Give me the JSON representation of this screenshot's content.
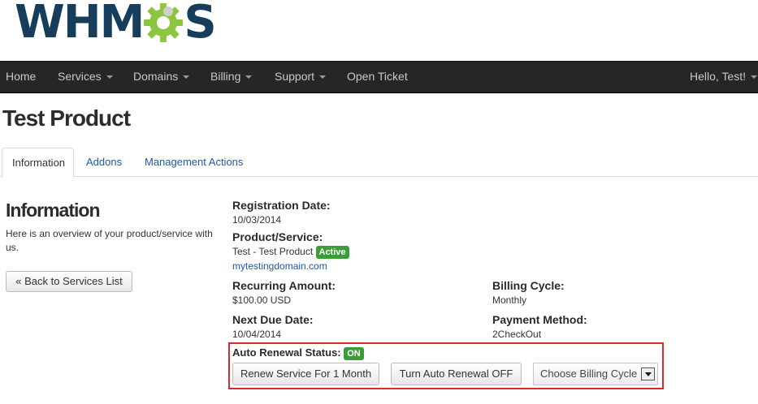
{
  "logo": {
    "text_before": "WHM",
    "text_after": "S"
  },
  "navbar": {
    "items": [
      {
        "label": "Home"
      },
      {
        "label": "Services"
      },
      {
        "label": "Domains"
      },
      {
        "label": "Billing"
      },
      {
        "label": "Support"
      },
      {
        "label": "Open Ticket"
      }
    ],
    "user_greeting": "Hello, Test!"
  },
  "page": {
    "title": "Test Product"
  },
  "tabs": [
    {
      "label": "Information"
    },
    {
      "label": "Addons"
    },
    {
      "label": "Management Actions"
    }
  ],
  "sidebar": {
    "heading": "Information",
    "description": "Here is an overview of your product/service with us.",
    "back_button": "« Back to Services List"
  },
  "details": {
    "registration_date_label": "Registration Date:",
    "registration_date": "10/03/2014",
    "product_label": "Product/Service:",
    "product_name": "Test - Test Product",
    "status_badge": "Active",
    "domain": "mytestingdomain.com",
    "recurring_label": "Recurring Amount:",
    "recurring_amount": "$100.00 USD",
    "billing_cycle_label": "Billing Cycle:",
    "billing_cycle": "Monthly",
    "next_due_label": "Next Due Date:",
    "next_due_date": "10/04/2014",
    "payment_method_label": "Payment Method:",
    "payment_method": "2CheckOut"
  },
  "auto_renewal": {
    "label": "Auto Renewal Status:",
    "status": "ON",
    "renew_button": "Renew Service For 1 Month",
    "toggle_button": "Turn Auto Renewal OFF",
    "billing_cycle_select": "Choose Billing Cycle"
  },
  "colors": {
    "navbar_bg": "#262626",
    "link": "#1e5aa8",
    "badge_green": "#3a9d3a",
    "highlight_red": "#d92a2a",
    "logo_blue": "#173d5c",
    "logo_green": "#8cc63f"
  }
}
